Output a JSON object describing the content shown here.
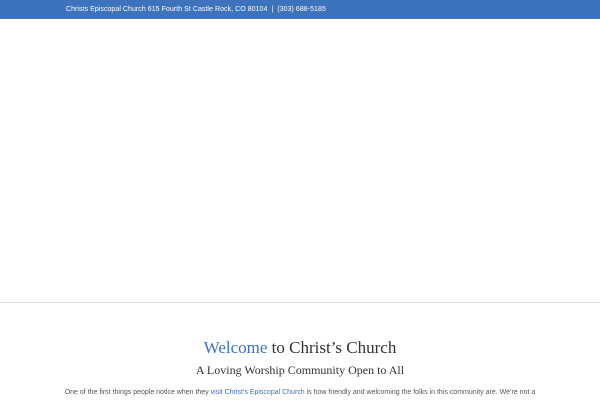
{
  "topbar": {
    "address": "Christs Episcopal Church 615 Fourth St Castle Rock, CO 80104",
    "separator": "|",
    "phone": "(303) 688-5185"
  },
  "welcome": {
    "heading_accent": "Welcome",
    "heading_rest": " to Christ’s Church",
    "subheading": "A Loving Worship Community Open to All"
  },
  "intro": {
    "text_before": "One of the first things people notice when they ",
    "link_text": "visit Christ’s Episcopal Church",
    "text_after": " is how friendly and welcoming the folks in this community are. We’re not a"
  },
  "colors": {
    "accent": "#3d72bd",
    "topbar_background": "#3d72bd",
    "heading_text": "#333333",
    "body_text": "#555555"
  }
}
